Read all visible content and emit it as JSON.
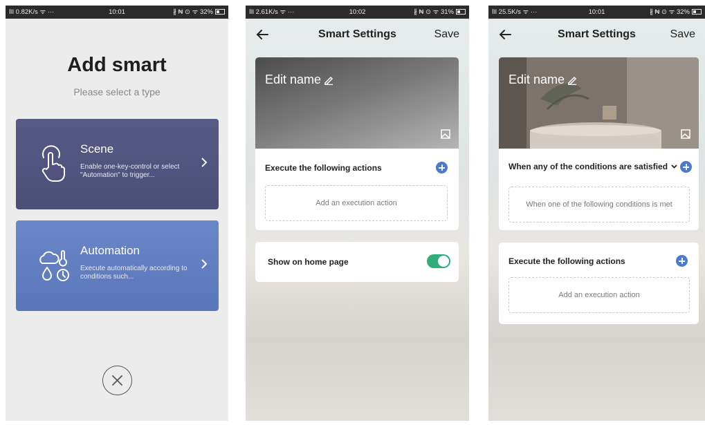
{
  "screen1": {
    "status": {
      "left": "ⵏll 0.82K/s ᯤ ···",
      "time": "10:01",
      "right": "∦ ₦ ⊙ ᯤ 32%"
    },
    "title": "Add smart",
    "subtitle": "Please select a type",
    "scene": {
      "title": "Scene",
      "desc": "Enable one-key-control or select \"Automation\" to trigger..."
    },
    "automation": {
      "title": "Automation",
      "desc": "Execute automatically according to conditions such..."
    },
    "colors": {
      "scene_card": "#4f537d",
      "automation_card": "#6580c4"
    }
  },
  "screen2": {
    "status": {
      "left": "ⵏll 2.61K/s ᯤ ···",
      "time": "10:02",
      "right": "∦ ₦ ⊙ ᯤ 31%"
    },
    "header": {
      "title": "Smart Settings",
      "save": "Save"
    },
    "edit_name": "Edit name",
    "actions_label": "Execute the following actions",
    "add_action": "Add an execution action",
    "show_home": "Show on home page",
    "show_home_enabled": true,
    "colors": {
      "toggle_on": "#2fae7a",
      "plus": "#4a7ad1"
    }
  },
  "screen3": {
    "status": {
      "left": "ⵏll 25.5K/s ᯤ ···",
      "time": "10:01",
      "right": "∦ ₦ ⊙ ᯤ 32%"
    },
    "header": {
      "title": "Smart Settings",
      "save": "Save"
    },
    "edit_name": "Edit name",
    "conditions_label": "When any of the conditions are satisfied",
    "conditions_placeholder": "When one of the following conditions is met",
    "actions_label": "Execute the following actions",
    "add_action": "Add an execution action"
  }
}
